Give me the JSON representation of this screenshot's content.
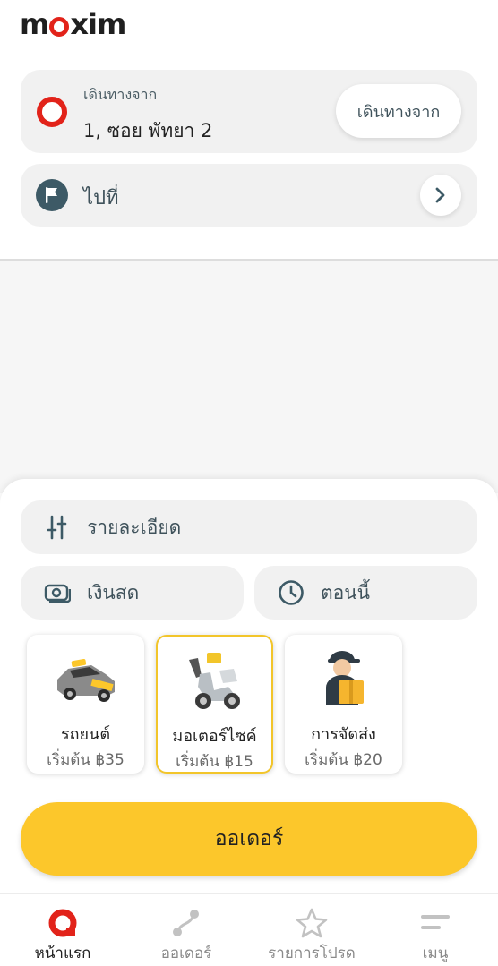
{
  "brand": {
    "logo_pre": "m",
    "logo_post": "xim"
  },
  "route": {
    "from_label": "เดินทางจาก",
    "from_value": "1, ซอย พัทยา 2",
    "from_button": "เดินทางจาก",
    "to_label": "ไปที่"
  },
  "options": {
    "details": "รายละเอียด",
    "payment": "เงินสด",
    "time": "ตอนนี้"
  },
  "services": [
    {
      "name": "รถยนต์",
      "price": "เริ่มต้น ฿35",
      "icon": "car-icon"
    },
    {
      "name": "มอเตอร์ไซค์",
      "price": "เริ่มต้น ฿15",
      "icon": "scooter-icon",
      "selected": true
    },
    {
      "name": "การจัดส่ง",
      "price": "เริ่มต้น ฿20",
      "icon": "courier-icon"
    }
  ],
  "order_button": "ออเดอร์",
  "nav": [
    {
      "label": "หน้าแรก",
      "active": true
    },
    {
      "label": "ออเดอร์"
    },
    {
      "label": "รายการโปรด"
    },
    {
      "label": "เมนู"
    }
  ],
  "colors": {
    "accent": "#e2231a",
    "order": "#fcc72b",
    "selected_border": "#f2c52a",
    "icon_dark": "#3d5a66"
  }
}
